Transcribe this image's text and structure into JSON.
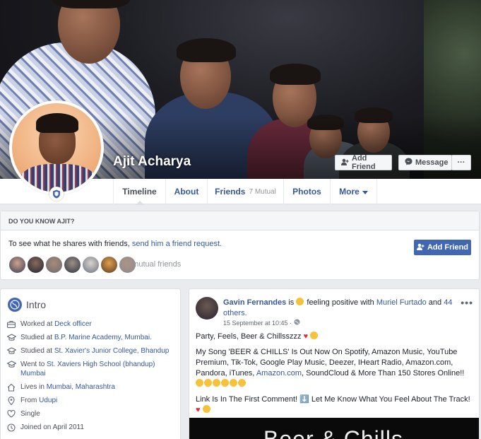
{
  "profile": {
    "name": "Ajit Acharya",
    "add_friend_label": "Add Friend",
    "message_label": "Message",
    "more_dots": "···"
  },
  "tabs": [
    {
      "label": "Timeline"
    },
    {
      "label": "About"
    },
    {
      "label": "Friends",
      "sub": "7 Mutual"
    },
    {
      "label": "Photos"
    },
    {
      "label": "More"
    }
  ],
  "know": {
    "heading": "DO YOU KNOW AJIT?",
    "text_prefix": "To see what he shares with friends, ",
    "text_link": "send him a friend request.",
    "mutual_count": "7 mutual friends",
    "add_friend_label": "Add Friend"
  },
  "intro": {
    "title": "Intro",
    "items": [
      {
        "icon": "briefcase-icon",
        "prefix": "Worked at ",
        "link": "Deck officer"
      },
      {
        "icon": "graduation-cap-icon",
        "prefix": "Studied at ",
        "link": "B.P. Marine Academy, Mumbai."
      },
      {
        "icon": "graduation-cap-icon",
        "prefix": "Studied at ",
        "link": "St. Xavier's Junior College, Bhandup"
      },
      {
        "icon": "graduation-cap-icon",
        "prefix": "Went to ",
        "link": "St. Xaviers High School (bhandup) Mumbai"
      },
      {
        "icon": "home-icon",
        "prefix": "Lives in ",
        "link": "Mumbai, Maharashtra"
      },
      {
        "icon": "location-pin-icon",
        "prefix": "From ",
        "link": "Udupi"
      },
      {
        "icon": "heart-outline-icon",
        "prefix": "Single",
        "link": ""
      },
      {
        "icon": "clock-icon",
        "prefix": "Joined on April 2011",
        "link": ""
      }
    ]
  },
  "post": {
    "author": "Gavin Fernandes",
    "activity_mid": " is ",
    "activity": " feeling positive with ",
    "tagged": "Muriel Furtado",
    "and": " and ",
    "others": "44 others.",
    "date": "15 September at 10:45 ·",
    "line1": "Party, Feels, Beer & Chillsszzz",
    "line2_a": "My Song 'BEER & CHILLS' Is Out Now On Spotify, Amazon Music, YouTube Premium, Tik-Tok, Google Play Music, Deezer, IHeart Radio, Amazon.com, Pandora, iTunes, ",
    "line2_link": "Amazon.com",
    "line2_b": ", SoundCloud & More Than 150 Stores Online!!",
    "line3": "Link Is In The First Comment! ⬇️ Let Me Know What You Feel About The Track!",
    "media_text": "Beer & Chills"
  },
  "colors": {
    "accent": "#4267b2",
    "link": "#365899",
    "page_bg": "#e9ebee"
  }
}
